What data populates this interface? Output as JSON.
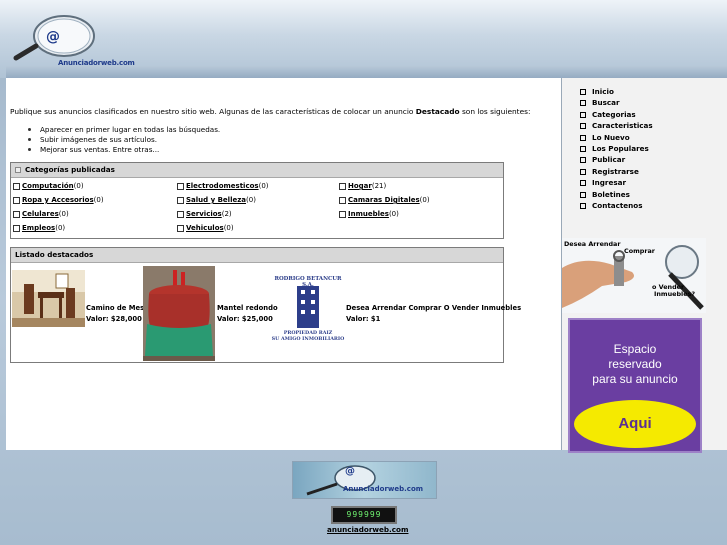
{
  "site": {
    "logo_text": "Anunciadorweb.com",
    "logo_at": "@"
  },
  "intro": {
    "text_before": "Publique sus anuncios clasificados en nuestro sitio web. Algunas de las características de colocar un anuncio ",
    "bold_word": "Destacado",
    "text_after": " son los siguientes:"
  },
  "benefits": [
    "Aparecer en primer lugar en todas las búsquedas.",
    "Subir imágenes de sus artículos.",
    "Mejorar sus ventas. Entre otras..."
  ],
  "categories": {
    "title": "Categorías publicadas",
    "items": [
      {
        "name": "Computación",
        "count": "(0)"
      },
      {
        "name": "Electrodomesticos",
        "count": "(0)"
      },
      {
        "name": "Hogar",
        "count": "(21)"
      },
      {
        "name": "Ropa y Accesorios",
        "count": "(0)"
      },
      {
        "name": "Salud y Belleza",
        "count": "(0)"
      },
      {
        "name": "Camaras Digitales",
        "count": "(0)"
      },
      {
        "name": "Celulares",
        "count": "(0)"
      },
      {
        "name": "Servicios",
        "count": "(2)"
      },
      {
        "name": "Inmuebles",
        "count": "(0)"
      },
      {
        "name": "Empleos",
        "count": "(0)"
      },
      {
        "name": "Vehiculos",
        "count": "(0)"
      }
    ]
  },
  "featured": {
    "title": "Listado destacados",
    "items": [
      {
        "name": "Camino de Mesa",
        "price": "Valor: $28,000"
      },
      {
        "name": "Mantel redondo",
        "price": "Valor: $25,000"
      },
      {
        "name": "Desea Arrendar Comprar O Vender Inmuebles",
        "price": "Valor: $1"
      }
    ],
    "realty_logo": {
      "name": "RODRIGO BETANCUR S.A.",
      "line1": "PROPIEDAD RAIZ",
      "line2": "SU AMIGO INMOBILIARIO"
    }
  },
  "nav": [
    "Inicio",
    "Buscar",
    "Categorias",
    "Caracteristicas",
    "Lo Nuevo",
    "Los Populares",
    "Publicar",
    "Registrarse",
    "Ingresar",
    "Boletines",
    "Contactenos"
  ],
  "ads": {
    "ad1": {
      "line1": "Desea Arrendar",
      "line2": "Comprar",
      "line3": "o Vender",
      "line4": "Inmuebles?"
    },
    "ad2": {
      "line1": "Espacio",
      "line2": "reservado",
      "line3": "para su anuncio",
      "button": "Aqui"
    }
  },
  "footer": {
    "counter": "999999",
    "link": "anunciadorweb.com",
    "logo_text": "Anunciadorweb.com"
  },
  "colors": {
    "ad_purple": "#6a3ea1",
    "ad_yellow": "#f5ea00",
    "realty_blue": "#2d3e8a"
  }
}
